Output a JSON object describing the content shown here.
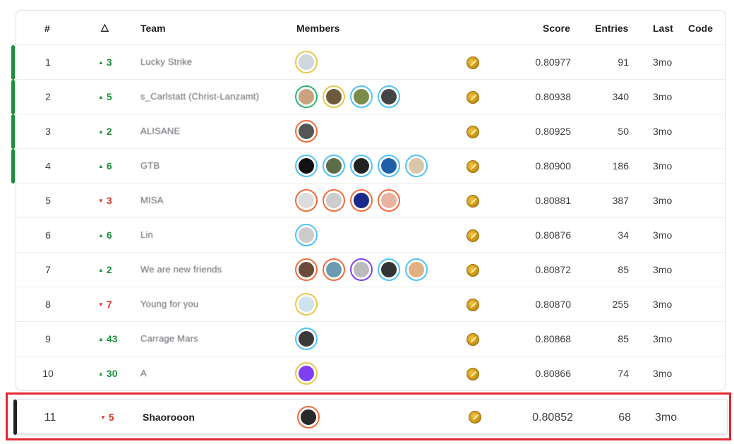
{
  "header": {
    "rank": "#",
    "delta": "△",
    "team": "Team",
    "members": "Members",
    "score": "Score",
    "entries": "Entries",
    "last": "Last",
    "code": "Code"
  },
  "rows": [
    {
      "rank": "1",
      "delta": "3",
      "dir": "up",
      "team": "Lucky Strike",
      "avatars": [
        [
          "#e8c84a",
          "#cfd8dc"
        ]
      ],
      "score": "0.80977",
      "entries": "91",
      "last": "3mo"
    },
    {
      "rank": "2",
      "delta": "5",
      "dir": "up",
      "team": "s_Carlstatt (Christ-Lanzamt)",
      "avatars": [
        [
          "#2bb673",
          "#c9a27e"
        ],
        [
          "#e8c84a",
          "#6d5a3c"
        ],
        [
          "#4fc3f7",
          "#7a8c4a"
        ],
        [
          "#4fc3f7",
          "#444"
        ]
      ],
      "score": "0.80938",
      "entries": "340",
      "last": "3mo"
    },
    {
      "rank": "3",
      "delta": "2",
      "dir": "up",
      "team": "ALISANE",
      "avatars": [
        [
          "#f26b3a",
          "#555"
        ]
      ],
      "score": "0.80925",
      "entries": "50",
      "last": "3mo"
    },
    {
      "rank": "4",
      "delta": "6",
      "dir": "up",
      "team": "GTB",
      "avatars": [
        [
          "#4fc3f7",
          "#111"
        ],
        [
          "#4fc3f7",
          "#5d6d4a"
        ],
        [
          "#4fc3f7",
          "#222"
        ],
        [
          "#4fc3f7",
          "#1f5fa8"
        ],
        [
          "#4fc3f7",
          "#d9c7a8"
        ]
      ],
      "score": "0.80900",
      "entries": "186",
      "last": "3mo"
    },
    {
      "rank": "5",
      "delta": "3",
      "dir": "down",
      "team": "MISA",
      "avatars": [
        [
          "#f26b3a",
          "#ddd"
        ],
        [
          "#f26b3a",
          "#ccc"
        ],
        [
          "#f26b3a",
          "#1b2a8a"
        ],
        [
          "#f26b3a",
          "#e8b4a0"
        ]
      ],
      "score": "0.80881",
      "entries": "387",
      "last": "3mo"
    },
    {
      "rank": "6",
      "delta": "6",
      "dir": "up",
      "team": "Lin",
      "avatars": [
        [
          "#4fc3f7",
          "#ccc"
        ]
      ],
      "score": "0.80876",
      "entries": "34",
      "last": "3mo"
    },
    {
      "rank": "7",
      "delta": "2",
      "dir": "up",
      "team": "We are new friends",
      "avatars": [
        [
          "#f26b3a",
          "#6b4a3a"
        ],
        [
          "#f26b3a",
          "#6a9bb0"
        ],
        [
          "#7e3ff2",
          "#bbb"
        ],
        [
          "#4fc3f7",
          "#333"
        ],
        [
          "#4fc3f7",
          "#e0b080"
        ]
      ],
      "score": "0.80872",
      "entries": "85",
      "last": "3mo"
    },
    {
      "rank": "8",
      "delta": "7",
      "dir": "down",
      "team": "Young for you",
      "avatars": [
        [
          "#e8c84a",
          "#cfe3ef"
        ]
      ],
      "score": "0.80870",
      "entries": "255",
      "last": "3mo"
    },
    {
      "rank": "9",
      "delta": "43",
      "dir": "up",
      "team": "Carrage Mars",
      "avatars": [
        [
          "#4fc3f7",
          "#3a3a3a"
        ]
      ],
      "score": "0.80868",
      "entries": "85",
      "last": "3mo"
    },
    {
      "rank": "10",
      "delta": "30",
      "dir": "up",
      "team": "A",
      "avatars": [
        [
          "#e8c84a",
          "#7e3ff2"
        ]
      ],
      "score": "0.80866",
      "entries": "74",
      "last": "3mo"
    }
  ],
  "self": {
    "rank": "11",
    "delta": "5",
    "dir": "down",
    "team": "Shaorooon",
    "avatars": [
      [
        "#f26b3a",
        "#2a2a2a"
      ]
    ],
    "score": "0.80852",
    "entries": "68",
    "last": "3mo"
  },
  "colors": {
    "up": "#1e8e3e",
    "down": "#d93025",
    "highlight": "#e3262f",
    "medal_bar": "#1e8e3e"
  },
  "icons": {
    "up": "triangle-up-icon",
    "down": "triangle-down-icon",
    "medal": "gold-medal-icon"
  }
}
